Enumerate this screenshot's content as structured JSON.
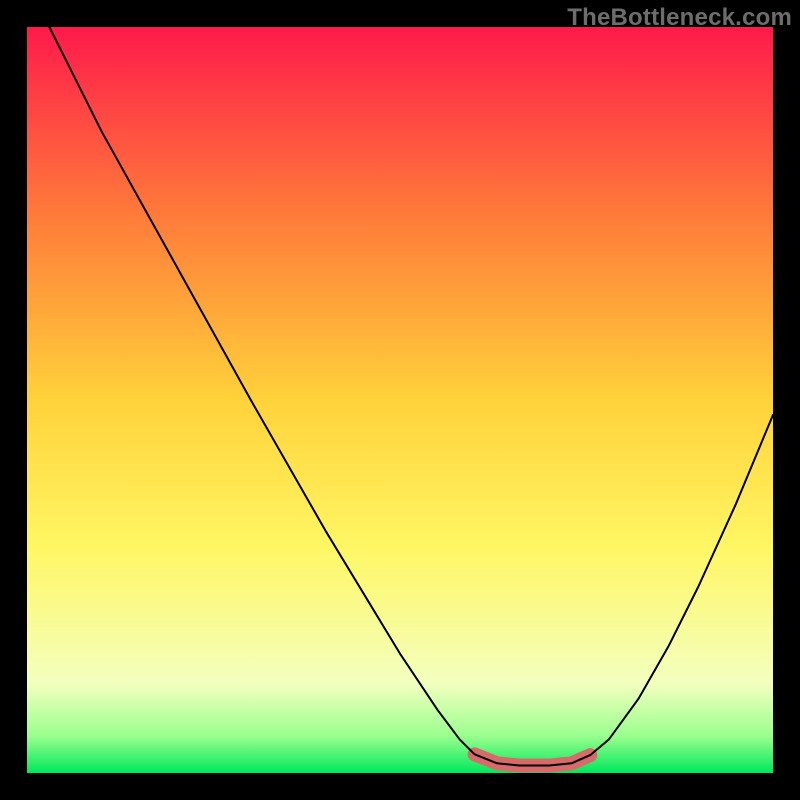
{
  "watermark": "TheBottleneck.com",
  "chart_data": {
    "type": "line",
    "title": "",
    "xlabel": "",
    "ylabel": "",
    "xlim": [
      0,
      100
    ],
    "ylim": [
      0,
      100
    ],
    "gradient_stops": [
      {
        "offset": 0,
        "color": "#ff1a4b"
      },
      {
        "offset": 25,
        "color": "#ff7a3a"
      },
      {
        "offset": 50,
        "color": "#ffd23a"
      },
      {
        "offset": 70,
        "color": "#fff765"
      },
      {
        "offset": 88,
        "color": "#f3ffbf"
      },
      {
        "offset": 95,
        "color": "#9bff8f"
      },
      {
        "offset": 100,
        "color": "#00e85c"
      }
    ],
    "series": [
      {
        "name": "bottleneck-curve",
        "color": "#000000",
        "width": 2,
        "points": [
          {
            "x": 3.0,
            "y": 100.0
          },
          {
            "x": 10.0,
            "y": 86.0
          },
          {
            "x": 20.0,
            "y": 68.0
          },
          {
            "x": 30.0,
            "y": 50.0
          },
          {
            "x": 40.0,
            "y": 32.5
          },
          {
            "x": 50.0,
            "y": 16.0
          },
          {
            "x": 55.0,
            "y": 8.5
          },
          {
            "x": 58.0,
            "y": 4.5
          },
          {
            "x": 60.0,
            "y": 2.5
          },
          {
            "x": 63.0,
            "y": 1.3
          },
          {
            "x": 66.0,
            "y": 1.0
          },
          {
            "x": 70.0,
            "y": 1.0
          },
          {
            "x": 73.0,
            "y": 1.3
          },
          {
            "x": 75.5,
            "y": 2.4
          },
          {
            "x": 78.0,
            "y": 4.5
          },
          {
            "x": 82.0,
            "y": 10.0
          },
          {
            "x": 86.0,
            "y": 17.0
          },
          {
            "x": 90.0,
            "y": 25.0
          },
          {
            "x": 95.0,
            "y": 36.0
          },
          {
            "x": 100.0,
            "y": 48.0
          }
        ]
      }
    ],
    "highlight": {
      "name": "optimal-zone",
      "color": "#d86a6a",
      "width": 14,
      "points": [
        {
          "x": 60.0,
          "y": 2.5
        },
        {
          "x": 63.0,
          "y": 1.3
        },
        {
          "x": 66.0,
          "y": 1.0
        },
        {
          "x": 70.0,
          "y": 1.0
        },
        {
          "x": 73.0,
          "y": 1.3
        },
        {
          "x": 75.5,
          "y": 2.4
        }
      ]
    }
  }
}
